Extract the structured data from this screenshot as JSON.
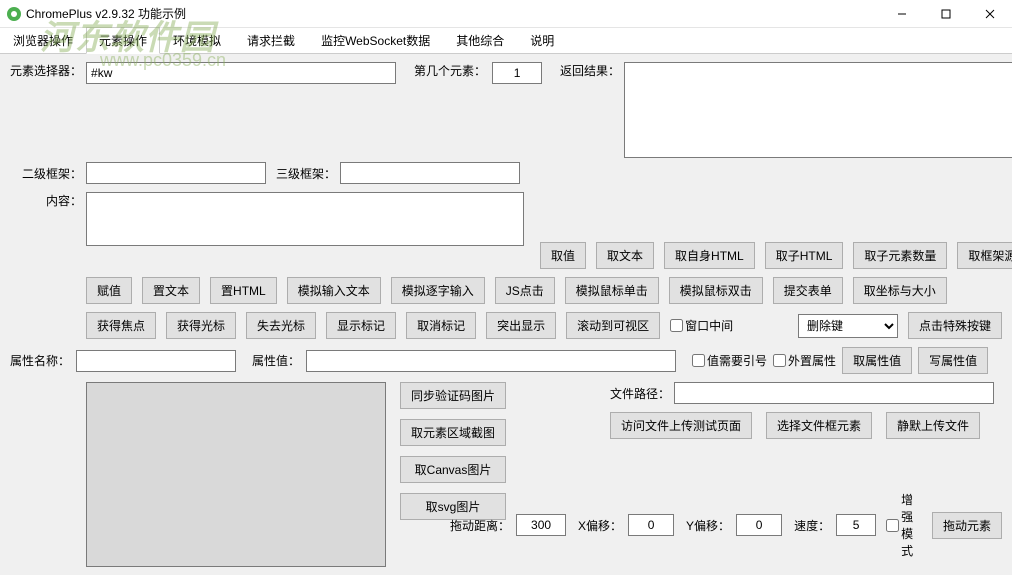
{
  "window": {
    "title": "ChromePlus v2.9.32 功能示例"
  },
  "watermark": {
    "line1": "河东软件园",
    "line2": "www.pc0359.cn"
  },
  "tabs": [
    "浏览器操作",
    "元素操作",
    "环境模拟",
    "请求拦截",
    "监控WebSocket数据",
    "其他综合",
    "说明"
  ],
  "labels": {
    "selector": "元素选择器：",
    "nthElement": "第几个元素：",
    "result": "返回结果：",
    "frame2": "二级框架：",
    "frame3": "三级框架：",
    "content": "内容：",
    "attrName": "属性名称：",
    "attrValue": "属性值：",
    "needQuote": "值需要引号",
    "externalAttr": "外置属性",
    "filePath": "文件路径：",
    "dragDistance": "拖动距离：",
    "xOffset": "X偏移：",
    "yOffset": "Y偏移：",
    "speed": "速度：",
    "enhancedMode": "增强模式",
    "windowCenter": "窗口中间"
  },
  "values": {
    "selector": "#kw",
    "nthElement": "1",
    "dragDistance": "300",
    "xOffset": "0",
    "yOffset": "0",
    "speed": "5",
    "keySelect": "删除键"
  },
  "buttons": {
    "getValue": "取值",
    "getText": "取文本",
    "getOwnHTML": "取自身HTML",
    "getChildHTML": "取子HTML",
    "getChildCount": "取子元素数量",
    "getFrameSource": "取框架源码",
    "setValue": "赋值",
    "setText": "置文本",
    "setHTML": "置HTML",
    "simInput": "模拟输入文本",
    "simTypeEach": "模拟逐字输入",
    "jsClick": "JS点击",
    "simSingleClick": "模拟鼠标单击",
    "simDoubleClick": "模拟鼠标双击",
    "submitForm": "提交表单",
    "getRectSize": "取坐标与大小",
    "getFocus": "获得焦点",
    "getCursor": "获得光标",
    "loseFocus": "失去光标",
    "showMark": "显示标记",
    "cancelMark": "取消标记",
    "highlight": "突出显示",
    "scrollIntoView": "滚动到可视区",
    "pressSpecialKey": "点击特殊按键",
    "getAttr": "取属性值",
    "setAttr": "写属性值",
    "syncCaptcha": "同步验证码图片",
    "getAreaShot": "取元素区域截图",
    "getCanvasImg": "取Canvas图片",
    "getSvgImg": "取svg图片",
    "visitUploadTest": "访问文件上传测试页面",
    "selectFileElement": "选择文件框元素",
    "silentUpload": "静默上传文件",
    "dragElement": "拖动元素"
  }
}
